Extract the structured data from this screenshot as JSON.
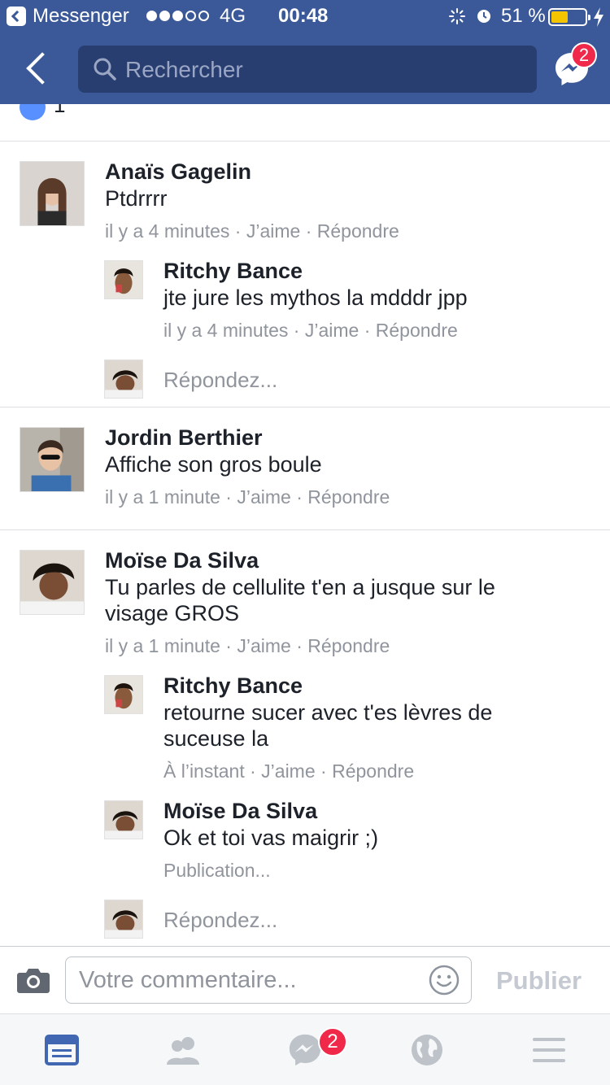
{
  "status_bar": {
    "app_back_label": "Messenger",
    "network": "4G",
    "time": "00:48",
    "battery_percent": "51 %",
    "battery_level": 0.51
  },
  "nav": {
    "search_placeholder": "Rechercher",
    "messenger_badge": "2"
  },
  "feed": {
    "like_count": "1",
    "comments": [
      {
        "author": "Anaïs Gagelin",
        "text": "Ptdrrrr",
        "time": "il y a 4 minutes",
        "like": "J’aime",
        "reply": "Répondre",
        "replies": [
          {
            "author": "Ritchy Bance",
            "text": "jte jure les mythos la mdddr jpp",
            "time": "il y a 4 minutes",
            "like": "J’aime",
            "reply": "Répondre"
          }
        ],
        "reply_placeholder": "Répondez..."
      },
      {
        "author": "Jordin Berthier",
        "text": "Affiche son gros boule",
        "time": "il y a 1 minute",
        "like": "J’aime",
        "reply": "Répondre"
      },
      {
        "author": "Moïse Da Silva",
        "text": "Tu parles de cellulite t'en a jusque sur le visage GROS",
        "time": "il y a 1 minute",
        "like": "J’aime",
        "reply": "Répondre",
        "replies": [
          {
            "author": "Ritchy Bance",
            "text": "retourne sucer avec t'es lèvres de suceuse la",
            "time": "À l’instant",
            "like": "J’aime",
            "reply": "Répondre"
          },
          {
            "author": "Moïse Da Silva",
            "text": "Ok et toi vas maigrir ;)",
            "status": "Publication..."
          }
        ],
        "reply_placeholder": "Répondez..."
      }
    ],
    "separator": "·"
  },
  "composer": {
    "placeholder": "Votre commentaire...",
    "publish_label": "Publier"
  },
  "tab_bar": {
    "messages_badge": "2"
  },
  "colors": {
    "brand": "#3b5998",
    "active_tab": "#4267b2",
    "badge": "#f02849",
    "meta_text": "#90949c"
  },
  "icons": [
    "messenger-app-back-icon",
    "search-icon",
    "messenger-icon",
    "like-icon",
    "camera-icon",
    "emoji-icon",
    "news-feed-icon",
    "friends-icon",
    "globe-icon",
    "menu-icon"
  ]
}
